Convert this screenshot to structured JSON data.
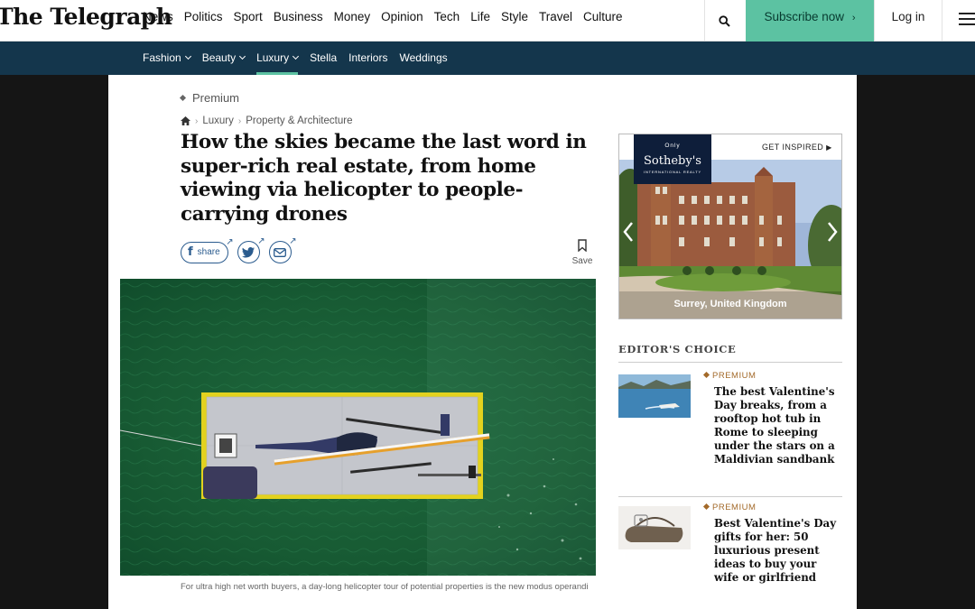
{
  "header": {
    "logo": "The Telegraph",
    "nav": [
      "News",
      "Politics",
      "Sport",
      "Business",
      "Money",
      "Opinion",
      "Tech",
      "Life",
      "Style",
      "Travel",
      "Culture"
    ],
    "active_nav": "Style",
    "subscribe_label": "Subscribe now",
    "login_label": "Log in"
  },
  "subnav": {
    "items": [
      "Fashion",
      "Beauty",
      "Luxury",
      "Stella",
      "Interiors",
      "Weddings"
    ],
    "active": "Luxury"
  },
  "article": {
    "premium_label": "Premium",
    "breadcrumb": [
      "Luxury",
      "Property & Architecture"
    ],
    "headline": "How the skies became the last word in super-rich real estate, from home viewing via helicopter to people-carrying drones",
    "share_label": "share",
    "save_label": "Save",
    "caption": "For ultra high net worth buyers, a day-long helicopter tour of potential properties is the new modus operandi"
  },
  "advert": {
    "brand_top": "Only",
    "brand": "Sotheby's",
    "brand_sub": "INTERNATIONAL REALTY",
    "cta": "GET INSPIRED",
    "location": "Surrey, United Kingdom"
  },
  "editors_choice": {
    "heading": "EDITOR'S CHOICE",
    "stories": [
      {
        "kicker": "PREMIUM",
        "title": "The best Valentine's Day breaks, from a rooftop hot tub in Rome to sleeping under the stars on a Maldivian sandbank"
      },
      {
        "kicker": "PREMIUM",
        "title": "Best Valentine's Day gifts for her: 50 luxurious present ideas to buy your wife or girlfriend"
      }
    ]
  },
  "colors": {
    "accent": "#5cc2a2",
    "subnav_bg": "#14364c",
    "share_blue": "#2a5b8e",
    "premium_gold": "#a36a2a"
  }
}
